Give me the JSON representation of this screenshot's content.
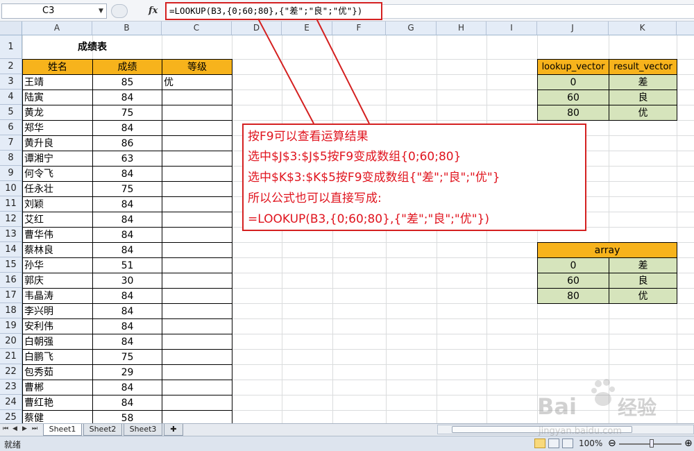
{
  "formula_bar": {
    "name_box": "C3",
    "fx_label": "fx",
    "formula": "=LOOKUP(B3,{0;60;80},{\"差\";\"良\";\"优\"})"
  },
  "columns": [
    "A",
    "B",
    "C",
    "D",
    "E",
    "F",
    "G",
    "H",
    "I",
    "J",
    "K"
  ],
  "rows": [
    "1",
    "2",
    "3",
    "4",
    "5",
    "6",
    "7",
    "8",
    "9",
    "10",
    "11",
    "12",
    "13",
    "14",
    "15",
    "16",
    "17",
    "18",
    "19",
    "20",
    "21",
    "22",
    "23",
    "24",
    "25"
  ],
  "table": {
    "title": "成绩表",
    "headers": [
      "姓名",
      "成绩",
      "等级"
    ],
    "records": [
      {
        "name": "王靖",
        "score": "85",
        "grade": "优"
      },
      {
        "name": "陆寅",
        "score": "84",
        "grade": ""
      },
      {
        "name": "黄龙",
        "score": "75",
        "grade": ""
      },
      {
        "name": "郑华",
        "score": "84",
        "grade": ""
      },
      {
        "name": "黄升良",
        "score": "86",
        "grade": ""
      },
      {
        "name": "谭湘宁",
        "score": "63",
        "grade": ""
      },
      {
        "name": "何令飞",
        "score": "84",
        "grade": ""
      },
      {
        "name": "任永壮",
        "score": "75",
        "grade": ""
      },
      {
        "name": "刘颖",
        "score": "84",
        "grade": ""
      },
      {
        "name": "艾红",
        "score": "84",
        "grade": ""
      },
      {
        "name": "曹华伟",
        "score": "84",
        "grade": ""
      },
      {
        "name": "蔡林良",
        "score": "84",
        "grade": ""
      },
      {
        "name": "孙华",
        "score": "51",
        "grade": ""
      },
      {
        "name": "郭庆",
        "score": "30",
        "grade": ""
      },
      {
        "name": "韦晶涛",
        "score": "84",
        "grade": ""
      },
      {
        "name": "李兴明",
        "score": "84",
        "grade": ""
      },
      {
        "name": "安利伟",
        "score": "84",
        "grade": ""
      },
      {
        "name": "白朝强",
        "score": "84",
        "grade": ""
      },
      {
        "name": "白鹏飞",
        "score": "75",
        "grade": ""
      },
      {
        "name": "包秀茹",
        "score": "29",
        "grade": ""
      },
      {
        "name": "曹郴",
        "score": "84",
        "grade": ""
      },
      {
        "name": "曹红艳",
        "score": "84",
        "grade": ""
      },
      {
        "name": "蔡健",
        "score": "58",
        "grade": ""
      }
    ]
  },
  "lookup_table": {
    "headers": [
      "lookup_vector",
      "result_vector"
    ],
    "rows": [
      {
        "vector": "0",
        "result": "差"
      },
      {
        "vector": "60",
        "result": "良"
      },
      {
        "vector": "80",
        "result": "优"
      }
    ]
  },
  "array_table": {
    "header": "array",
    "rows": [
      {
        "vector": "0",
        "result": "差"
      },
      {
        "vector": "60",
        "result": "良"
      },
      {
        "vector": "80",
        "result": "优"
      }
    ]
  },
  "annotation": {
    "lines": [
      "按F9可以查看运算结果",
      "选中$J$3:$J$5按F9变成数组{0;60;80}",
      "选中$K$3:$K$5按F9变成数组{\"差\";\"良\";\"优\"}",
      "所以公式也可以直接写成:",
      "=LOOKUP(B3,{0;60;80},{\"差\";\"良\";\"优\"})"
    ]
  },
  "sheet_tabs": [
    "Sheet1",
    "Sheet2",
    "Sheet3"
  ],
  "status_bar": {
    "status": "就绪",
    "zoom": "100%"
  },
  "watermark": {
    "brand": "Baidu经验",
    "url": "jingyan.baidu.com"
  },
  "colors": {
    "header_orange": "#f7b31c",
    "lookup_green": "#d6e4bc",
    "annotation_red": "#d42020"
  }
}
